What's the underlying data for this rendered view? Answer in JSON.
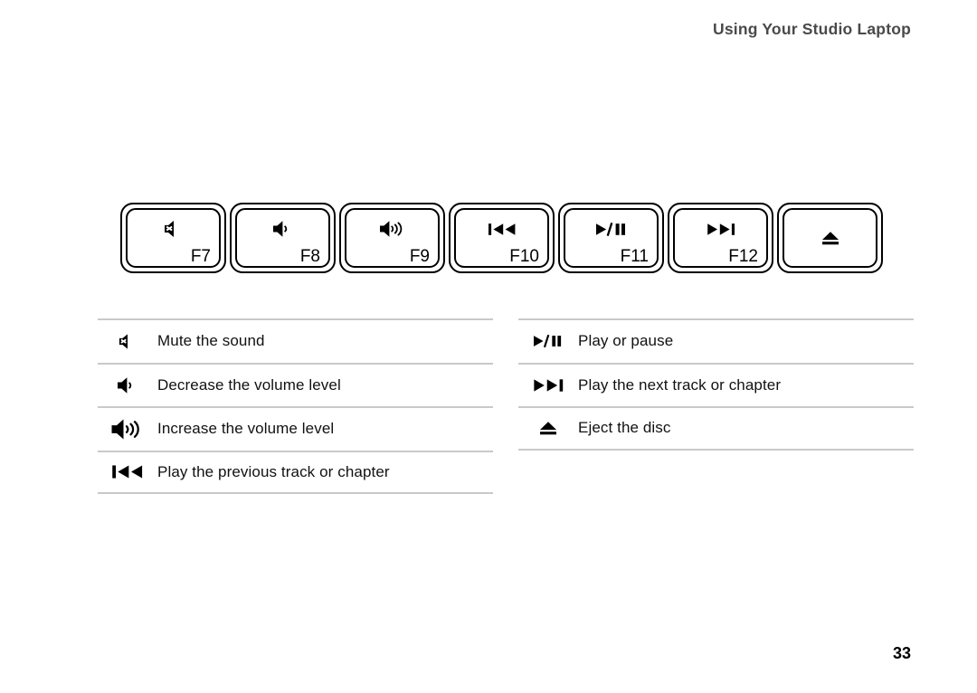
{
  "header": {
    "title": "Using Your Studio Laptop"
  },
  "keyboard": {
    "keys": [
      {
        "label": "F7",
        "icon": "mute-speaker-icon",
        "icon_position": "top"
      },
      {
        "label": "F8",
        "icon": "volume-down-speaker-icon",
        "icon_position": "top"
      },
      {
        "label": "F9",
        "icon": "volume-up-speaker-icon",
        "icon_position": "top"
      },
      {
        "label": "F10",
        "icon": "previous-track-icon",
        "icon_position": "top"
      },
      {
        "label": "F11",
        "icon": "play-pause-icon",
        "icon_position": "top"
      },
      {
        "label": "F12",
        "icon": "next-track-icon",
        "icon_position": "top"
      },
      {
        "label": "",
        "icon": "eject-icon",
        "icon_position": "center"
      }
    ]
  },
  "legend": {
    "left_column": [
      {
        "icon": "mute-speaker-icon",
        "text": "Mute the sound"
      },
      {
        "icon": "volume-down-speaker-icon",
        "text": "Decrease the volume level"
      },
      {
        "icon": "volume-up-speaker-icon",
        "text": "Increase the volume level"
      },
      {
        "icon": "previous-track-icon",
        "text": "Play the previous track or chapter"
      }
    ],
    "right_column": [
      {
        "icon": "play-pause-icon",
        "text": "Play or pause"
      },
      {
        "icon": "next-track-icon",
        "text": "Play the next track or chapter"
      },
      {
        "icon": "eject-icon",
        "text": "Eject the disc"
      }
    ]
  },
  "footer": {
    "page_number": "33"
  },
  "colors": {
    "header_text": "#4a4a4a",
    "body_text": "#111111",
    "rule": "#c9c9c9",
    "key_outline": "#000000",
    "background": "#ffffff"
  }
}
